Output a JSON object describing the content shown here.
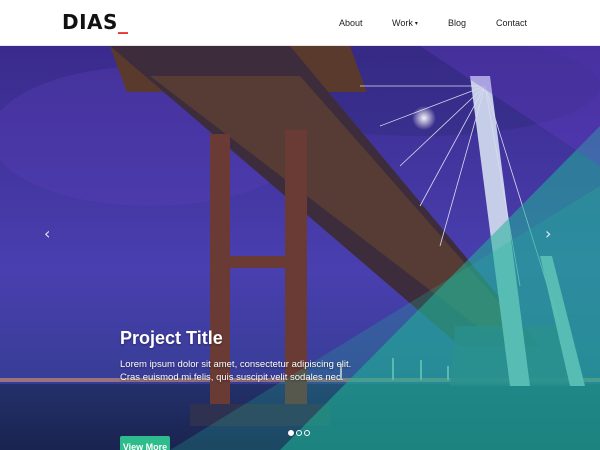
{
  "brand": {
    "name": "DIAS",
    "cursor": "_",
    "cursor_color": "#e53935"
  },
  "nav": {
    "items": [
      {
        "label": "About"
      },
      {
        "label": "Work",
        "has_dropdown": true,
        "caret": "▾"
      },
      {
        "label": "Blog"
      },
      {
        "label": "Contact"
      }
    ]
  },
  "slider": {
    "prev_icon": "‹",
    "next_icon": "›",
    "caption": {
      "title": "Project Title",
      "lines": [
        "Lorem ipsum dolor sit amet, consectetur adipiscing elit.",
        "Cras euismod mi felis, quis suscipit velit sodales nec."
      ],
      "button_label": "View More",
      "button_color": "#2ebc8c"
    },
    "slide_count": 3,
    "active_slide": 1
  },
  "colors": {
    "overlay_purple": "#6a3fd1",
    "overlay_teal": "#1fb597"
  }
}
